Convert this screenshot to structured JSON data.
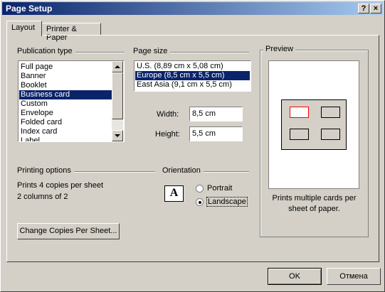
{
  "window": {
    "title": "Page Setup",
    "help_label": "?",
    "close_label": "×"
  },
  "tabs": [
    {
      "label": "Layout"
    },
    {
      "label": "Printer & Paper"
    }
  ],
  "publication_type": {
    "label": "Publication type",
    "items": [
      "Full page",
      "Banner",
      "Booklet",
      "Business card",
      "Custom",
      "Envelope",
      "Folded card",
      "Index card",
      "Label"
    ],
    "selected": "Business card"
  },
  "page_size": {
    "label": "Page size",
    "items": [
      "U.S. (8,89 cm x 5,08 cm)",
      "Europe (8,5 cm x 5,5 cm)",
      "East Asia (9,1 cm x 5,5 cm)"
    ],
    "selected": "Europe (8,5 cm x 5,5 cm)"
  },
  "dimensions": {
    "width_label": "Width:",
    "width_value": "8,5 cm",
    "height_label": "Height:",
    "height_value": "5,5 cm"
  },
  "printing_options": {
    "label": "Printing options",
    "line1": "Prints 4 copies per sheet",
    "line2": "2 columns of 2",
    "change_button": "Change Copies Per Sheet..."
  },
  "orientation": {
    "label": "Orientation",
    "icon_letter": "A",
    "portrait": "Portrait",
    "landscape": "Landscape",
    "selected": "landscape"
  },
  "preview": {
    "label": "Preview",
    "caption_line1": "Prints multiple cards per",
    "caption_line2": "sheet of paper."
  },
  "buttons": {
    "ok": "OK",
    "cancel": "Отмена"
  },
  "colors": {
    "title_start": "#0a246a",
    "title_end": "#a6caf0",
    "selection": "#0a246a",
    "preview_highlight": "#ff0000"
  }
}
